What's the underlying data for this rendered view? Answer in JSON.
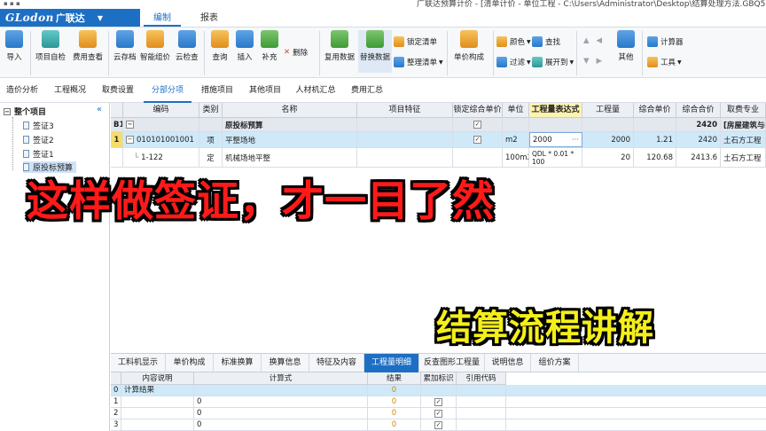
{
  "window": {
    "path": "广联达预算计价 - [清单计价 - 单位工程 - C:\\Users\\Administrator\\Desktop\\结算处理方法.GBQ5]"
  },
  "logo": {
    "en": "GLodon",
    "cn": "广联达"
  },
  "menu_tabs": [
    "编制",
    "报表"
  ],
  "ribbon": {
    "import": "导入",
    "self_check": "项目自检",
    "fee_view": "费用查看",
    "cloud_archive": "云存档",
    "smart_price": "智能组价",
    "cloud_check": "云检查",
    "query": "查询",
    "insert": "插入",
    "supplement": "补充",
    "delete": "删除",
    "copy_data": "复用数据",
    "replace_data": "替换数据",
    "lock_list": "锁定清单",
    "organize_list": "整理清单",
    "unit_price": "单价构成",
    "color": "颜色",
    "filter": "过滤",
    "find": "查找",
    "expand_to": "展开到",
    "other": "其他",
    "calculator": "计算器",
    "tools": "工具"
  },
  "sub_tabs": [
    "造价分析",
    "工程概况",
    "取费设置",
    "分部分项",
    "措施项目",
    "其他项目",
    "人材机汇总",
    "费用汇总"
  ],
  "tree": {
    "root": "整个项目",
    "items": [
      "签证3",
      "签证2",
      "签证1",
      "原投标预算"
    ]
  },
  "grid": {
    "headers": [
      "编码",
      "类别",
      "名称",
      "项目特征",
      "锁定综合单价",
      "单位",
      "工程量表达式",
      "工程量",
      "综合单价",
      "综合合价",
      "取费专业"
    ],
    "rows": [
      {
        "no": "B1",
        "code": "",
        "type": "",
        "name": "原投标预算",
        "feature": "",
        "unit": "",
        "expr": "",
        "qty": "",
        "price": "",
        "total": "2420",
        "fee": "[房屋建筑与装饰工程]"
      },
      {
        "no": "1",
        "code": "010101001001",
        "type": "项",
        "name": "平整场地",
        "feature": "",
        "unit": "m2",
        "expr": "2000",
        "qty": "2000",
        "price": "1.21",
        "total": "2420",
        "fee": "土石方工程"
      },
      {
        "no": "",
        "code": "1-122",
        "type": "定",
        "name": "机械场地平整",
        "feature": "",
        "unit": "100m2",
        "expr": "QDL * 0.01 * 100",
        "qty": "20",
        "price": "120.68",
        "total": "2413.6",
        "fee": "土石方工程"
      }
    ],
    "expr_more": "···"
  },
  "bottom_tabs": [
    "工料机显示",
    "单价构成",
    "标准换算",
    "换算信息",
    "特征及内容",
    "工程量明细",
    "反查图形工程量",
    "说明信息",
    "组价方案"
  ],
  "bottom_grid": {
    "headers": [
      "内容说明",
      "计算式",
      "结果",
      "累加标识",
      "引用代码"
    ],
    "rows": [
      {
        "no": "0",
        "desc": "计算结果",
        "formula": "",
        "result": "0"
      },
      {
        "no": "1",
        "desc": "",
        "formula": "0",
        "result": "0"
      },
      {
        "no": "2",
        "desc": "",
        "formula": "0",
        "result": "0"
      },
      {
        "no": "3",
        "desc": "",
        "formula": "0",
        "result": "0"
      }
    ]
  },
  "captions": {
    "main": "这样做签证，才一目了然",
    "sub": "结算流程讲解"
  },
  "colors": {
    "brand": "#1d6fc4",
    "caption_main": "#ff1a1a",
    "caption_sub": "#f4ef1a",
    "selected_row": "#cfe9f9",
    "highlight_header": "#fdf3b0"
  }
}
